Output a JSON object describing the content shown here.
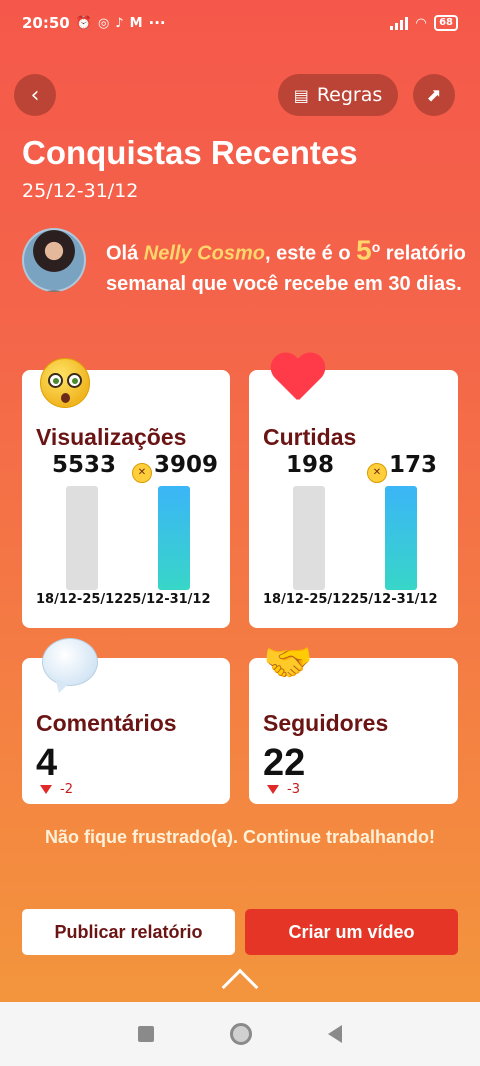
{
  "status_bar": {
    "time": "20:50",
    "left_icons": [
      "alarm-icon",
      "whatsapp-icon",
      "tiktok-icon",
      "gmail-icon"
    ],
    "more": "···",
    "battery": "68"
  },
  "header": {
    "rules_label": "Regras",
    "title": "Conquistas Recentes",
    "date_range": "25/12-31/12"
  },
  "greeting": {
    "prefix": "Olá ",
    "name": "Nelly Cosmo",
    "middle": ", este é o ",
    "number": "5",
    "ordinal": "o",
    "suffix": " relatório semanal que você recebe em 30 dias."
  },
  "cards": {
    "views": {
      "title": "Visualizações",
      "previous_value": "5533",
      "current_value": "3909",
      "previous_period": "18/12-25/12",
      "current_period": "25/12-31/12"
    },
    "likes": {
      "title": "Curtidas",
      "previous_value": "198",
      "current_value": "173",
      "previous_period": "18/12-25/12",
      "current_period": "25/12-31/12"
    },
    "comments": {
      "title": "Comentários",
      "value": "4",
      "delta": "-2"
    },
    "followers": {
      "title": "Seguidores",
      "value": "22",
      "delta": "-3"
    }
  },
  "encouragement": "Não fique frustrado(a). Continue trabalhando!",
  "actions": {
    "publish": "Publicar relatório",
    "create_video": "Criar um vídeo"
  },
  "colors": {
    "accent_red": "#e53526",
    "title_dark_red": "#6b1414",
    "highlight_yellow": "#ffd66b"
  }
}
